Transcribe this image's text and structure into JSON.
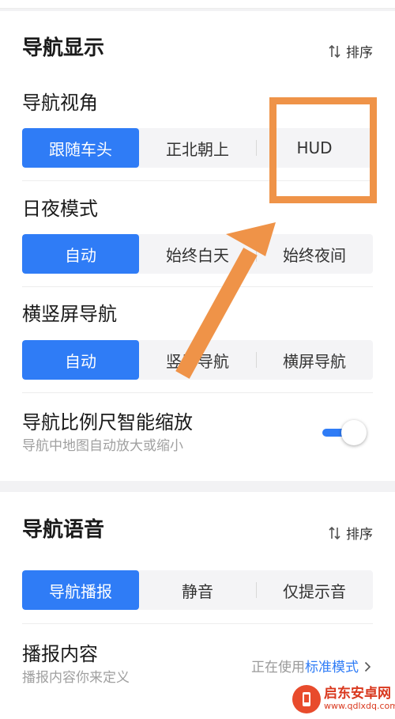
{
  "nav_display": {
    "title": "导航显示",
    "sort_label": "排序",
    "view_angle": {
      "title": "导航视角",
      "options": [
        "跟随车头",
        "正北朝上",
        "HUD"
      ],
      "selected": 0
    },
    "day_night": {
      "title": "日夜模式",
      "options": [
        "自动",
        "始终白天",
        "始终夜间"
      ],
      "selected": 0
    },
    "orientation": {
      "title": "横竖屏导航",
      "options": [
        "自动",
        "竖屏导航",
        "横屏导航"
      ],
      "selected": 0
    },
    "smart_scale": {
      "title": "导航比例尺智能缩放",
      "subtitle": "导航中地图自动放大或缩小",
      "enabled": true
    }
  },
  "nav_voice": {
    "title": "导航语音",
    "sort_label": "排序",
    "mode": {
      "options": [
        "导航播报",
        "静音",
        "仅提示音"
      ],
      "selected": 0
    },
    "broadcast_content": {
      "title": "播报内容",
      "subtitle": "播报内容你来定义",
      "status_prefix": "正在使用",
      "status_value": "标准模式"
    }
  },
  "watermark": {
    "name": "启东安卓网",
    "url": "www.qdlxdq.com"
  },
  "colors": {
    "accent": "#2f7cf6",
    "annotation": "#ef9348"
  }
}
